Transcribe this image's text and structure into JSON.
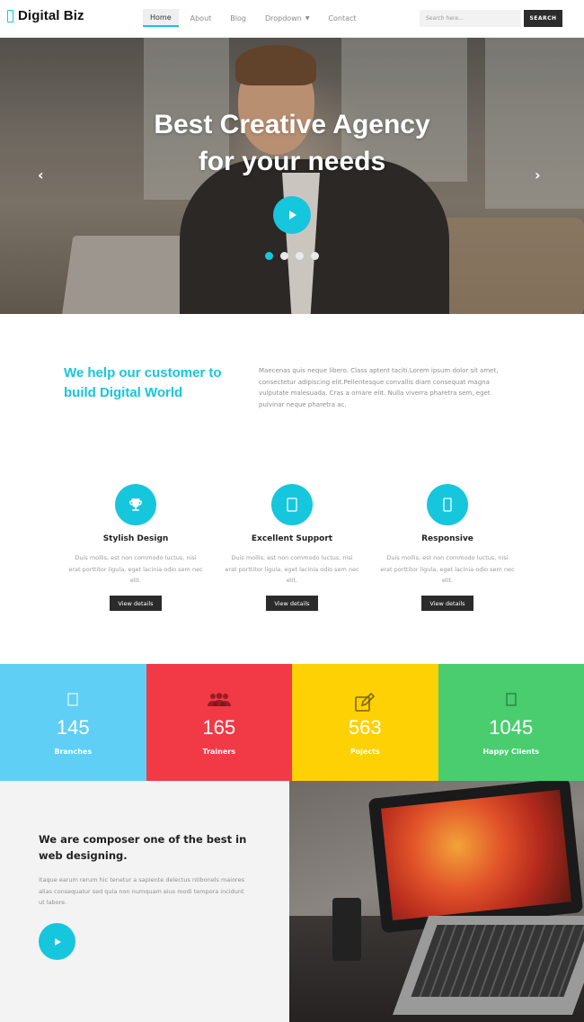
{
  "header": {
    "logo": "Digital Biz",
    "nav": [
      {
        "label": "Home",
        "active": true
      },
      {
        "label": "About"
      },
      {
        "label": "Blog"
      },
      {
        "label": "Dropdown",
        "has_caret": true
      },
      {
        "label": "Contact"
      }
    ],
    "search_placeholder": "Search here...",
    "search_button": "SEARCH"
  },
  "hero": {
    "title_line1": "Best Creative Agency",
    "title_line2": "for your needs",
    "slides": 4,
    "active_slide": 1,
    "prev_icon": "chevron-left-icon",
    "next_icon": "chevron-right-icon"
  },
  "about": {
    "heading_line1": "We help our customer to",
    "heading_line2": "build Digital World",
    "text": "Maecenas quis neque libero. Class aptent taciti.Lorem ipsum dolor sit amet, consectetur adipiscing elit.Pellentesque convallis diam consequat magna vulputate malesuada. Cras a ornare elit. Nulla viverra pharetra sem, eget pulvinar neque pharetra ac."
  },
  "features": [
    {
      "title": "Stylish Design",
      "icon": "trophy-icon",
      "text": "Duis mollis, est non commodo luctus, nisi erat porttitor ligula, eget lacinia odio sem nec elit.",
      "button": "View details"
    },
    {
      "title": "Excellent Support",
      "icon": "support-icon",
      "text": "Duis mollis, est non commodo luctus, nisi erat porttitor ligula, eget lacinia odio sem nec elit.",
      "button": "View details"
    },
    {
      "title": "Responsive",
      "icon": "mobile-icon",
      "text": "Duis mollis, est non commodo luctus, nisi erat porttitor ligula, eget lacinia odio sem nec elit.",
      "button": "View details"
    }
  ],
  "stats": [
    {
      "value": "145",
      "label": "Branches",
      "icon": "building-icon",
      "color": "#5fcff5"
    },
    {
      "value": "165",
      "label": "Trainers",
      "icon": "users-icon",
      "color": "#f13a45"
    },
    {
      "value": "563",
      "label": "Pojects",
      "icon": "edit-icon",
      "color": "#fed105"
    },
    {
      "value": "1045",
      "label": "Happy Clients",
      "icon": "smile-icon",
      "color": "#49cd6e"
    }
  ],
  "composer": {
    "title": "We are composer one of the best in web designing.",
    "text": "Itaque earum rerum hic tenetur a sapiente delectus ntibonels maiores alias consequatur sed quia non numquam eius modi tempora incidunt ut labore."
  },
  "colors": {
    "accent": "#16c6dd",
    "dark": "#2b2b2b"
  }
}
